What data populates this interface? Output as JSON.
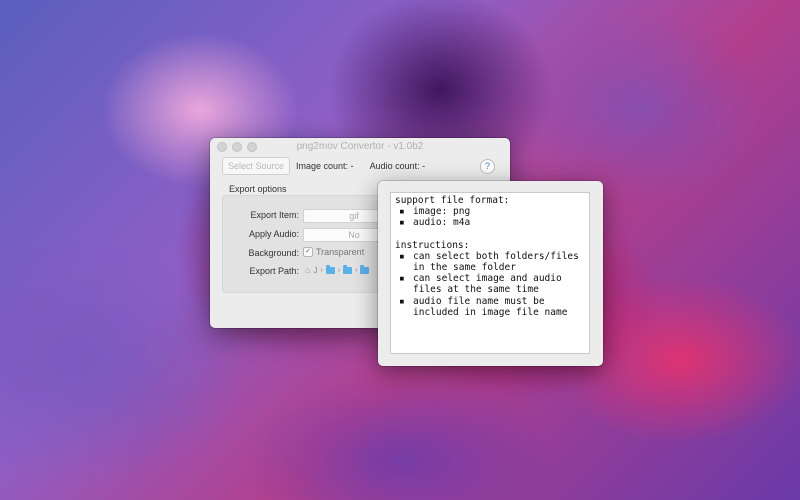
{
  "window": {
    "title": "png2mov Convertor - v1.0b2",
    "toolbar": {
      "select_source_label": "Select Source",
      "image_count": "Image count: -",
      "audio_count": "Audio count: -",
      "help_label": "?"
    },
    "export_options": {
      "heading": "Export options",
      "export_item": {
        "label": "Export Item:",
        "value": "gif"
      },
      "apply_audio": {
        "label": "Apply Audio:",
        "value": "No"
      },
      "background": {
        "label": "Background:",
        "checkbox_label": "Transparent",
        "checked": true,
        "check_glyph": "✓"
      },
      "export_path": {
        "label": "Export Path:",
        "home_text": "J",
        "sep": "›"
      }
    }
  },
  "help_popover": {
    "section1_title": "support file format:",
    "formats": [
      "image: png",
      "audio: m4a"
    ],
    "section2_title": "instructions:",
    "instructions": [
      [
        "can select both folders/files",
        "in the same folder"
      ],
      [
        "can select image and audio",
        "files at the same time"
      ],
      [
        "audio file name must be",
        "included in image file name"
      ]
    ],
    "bullet": "▪"
  },
  "colors": {
    "accent": "#2f7fe0",
    "folder": "#5ab0e8",
    "window_bg": "#ececec"
  }
}
